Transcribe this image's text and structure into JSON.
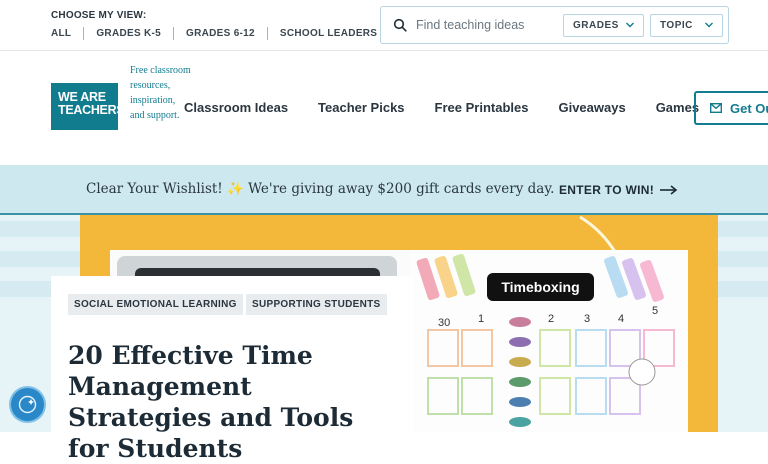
{
  "view": {
    "title": "CHOOSE MY VIEW:",
    "links": [
      "ALL",
      "GRADES K-5",
      "GRADES 6-12",
      "SCHOOL LEADERS"
    ]
  },
  "search": {
    "placeholder": "Find teaching ideas",
    "grades_label": "GRADES",
    "topic_label": "TOPIC"
  },
  "logo": {
    "line1": "WE ARE",
    "line2": "TEACHERS",
    "tagline": "Free classroom resources, inspiration, and support."
  },
  "nav": {
    "items": [
      "Classroom Ideas",
      "Teacher Picks",
      "Free Printables",
      "Giveaways",
      "Games"
    ],
    "cta_label": "Get Ou"
  },
  "banner": {
    "text": "Clear Your Wishlist! ✨ We're giving away $200 gift cards every day.",
    "cta": "ENTER TO WIN!"
  },
  "article": {
    "tags": [
      "SOCIAL EMOTIONAL LEARNING",
      "SUPPORTING STUDENTS"
    ],
    "title": "20 Effective Time Management Strategies and Tools for Students",
    "image_label": "Timeboxing",
    "planner_numbers": [
      "30",
      "1",
      "2",
      "3",
      "4",
      "5"
    ]
  },
  "colors": {
    "brand": "#127c8f",
    "banner_bg": "#cde8ee",
    "hero_yellow": "#f3b83a"
  }
}
